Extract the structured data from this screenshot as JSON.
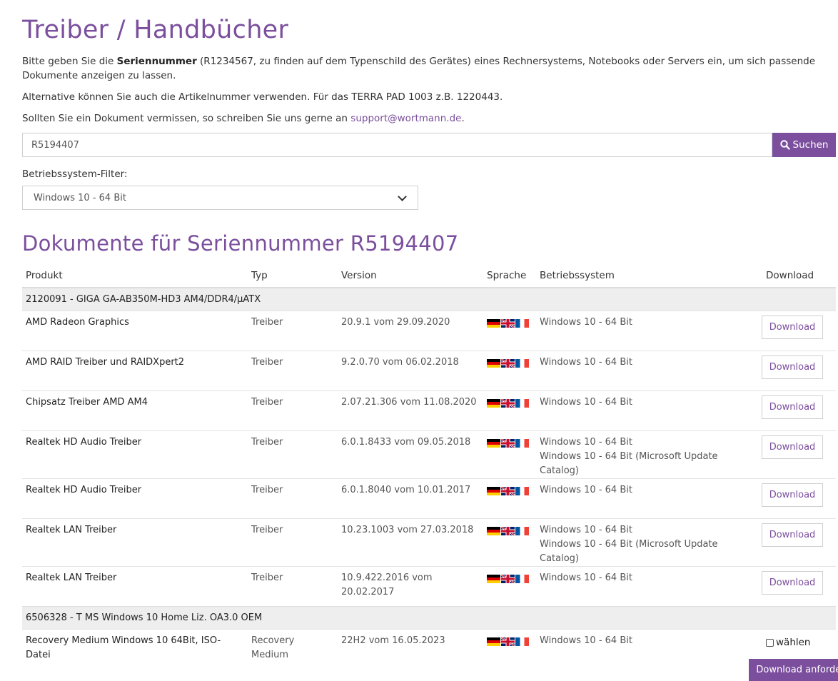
{
  "header": {
    "title": "Treiber / Handbücher",
    "intro_before": "Bitte geben Sie die ",
    "intro_bold": "Seriennummer",
    "intro_after": " (R1234567, zu finden auf dem Typenschild des Gerätes) eines Rechnersystems, Notebooks oder Servers ein, um sich passende Dokumente anzeigen zu lassen.",
    "alt_text": "Alternative können Sie auch die Artikelnummer verwenden. Für das TERRA PAD 1003 z.B. 1220443.",
    "missing_before": "Sollten Sie ein Dokument vermissen, so schreiben Sie uns gerne an ",
    "missing_link": "support@wortmann.de",
    "missing_after": "."
  },
  "search": {
    "value": "R5194407",
    "button_label": "Suchen"
  },
  "os_filter": {
    "label": "Betriebssystem-Filter:",
    "selected": "Windows 10 - 64 Bit"
  },
  "results": {
    "heading": "Dokumente für Seriennummer R5194407",
    "columns": [
      "Produkt",
      "Typ",
      "Version",
      "Sprache",
      "Betriebssystem",
      "Download"
    ],
    "groups": [
      {
        "name": "2120091 - GIGA GA-AB350M-HD3 AM4/DDR4/µATX",
        "rows": [
          {
            "product": "AMD Radeon Graphics",
            "type": "Treiber",
            "version": "20.9.1 vom 29.09.2020",
            "os": [
              "Windows 10 - 64 Bit"
            ],
            "action": "Download"
          },
          {
            "product": "AMD RAID Treiber und RAIDXpert2",
            "type": "Treiber",
            "version": "9.2.0.70 vom 06.02.2018",
            "os": [
              "Windows 10 - 64 Bit"
            ],
            "action": "Download"
          },
          {
            "product": "Chipsatz Treiber AMD AM4",
            "type": "Treiber",
            "version": "2.07.21.306 vom 11.08.2020",
            "os": [
              "Windows 10 - 64 Bit"
            ],
            "action": "Download"
          },
          {
            "product": "Realtek HD Audio Treiber",
            "type": "Treiber",
            "version": "6.0.1.8433 vom 09.05.2018",
            "os": [
              "Windows 10 - 64 Bit",
              "Windows 10 - 64 Bit (Microsoft Update Catalog)"
            ],
            "action": "Download"
          },
          {
            "product": "Realtek HD Audio Treiber",
            "type": "Treiber",
            "version": "6.0.1.8040 vom 10.01.2017",
            "os": [
              "Windows 10 - 64 Bit"
            ],
            "action": "Download"
          },
          {
            "product": "Realtek LAN Treiber",
            "type": "Treiber",
            "version": "10.23.1003 vom 27.03.2018",
            "os": [
              "Windows 10 - 64 Bit",
              "Windows 10 - 64 Bit (Microsoft Update Catalog)"
            ],
            "action": "Download"
          },
          {
            "product": "Realtek LAN Treiber",
            "type": "Treiber",
            "version": "10.9.422.2016 vom 20.02.2017",
            "os": [
              "Windows 10 - 64 Bit"
            ],
            "action": "Download"
          }
        ]
      },
      {
        "name": "6506328 - T MS Windows 10 Home Liz. OA3.0 OEM",
        "rows": [
          {
            "product": "Recovery Medium Windows 10 64Bit, ISO-Datei",
            "type": "Recovery Medium",
            "version": "22H2 vom 16.05.2023",
            "os": [
              "Windows 10 - 64 Bit"
            ],
            "action": "wählen"
          }
        ]
      }
    ],
    "languages": [
      "flag-de-icon",
      "flag-en-icon",
      "flag-fr-icon"
    ],
    "request_button": "Download anfordern"
  },
  "colors": {
    "accent": "#7b4f9d",
    "group_bg": "#eeeeee"
  }
}
